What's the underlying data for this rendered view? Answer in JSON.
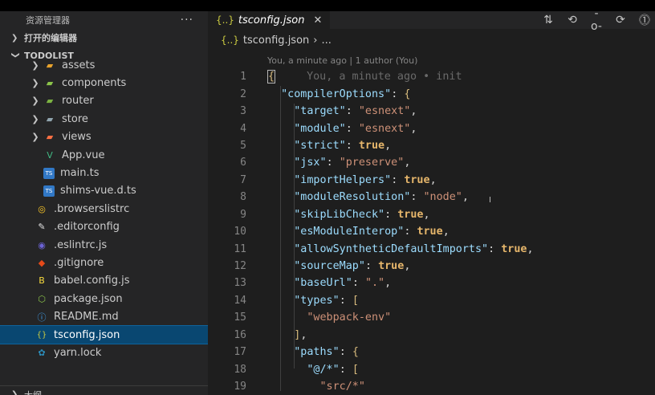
{
  "sidebar": {
    "title": "资源管理器",
    "more": "···",
    "open_editors": "打开的编辑器",
    "project": "TODOLIST",
    "items": [
      {
        "label": "assets",
        "type": "folder",
        "color": "#e8a32d",
        "icon": "folder-icon"
      },
      {
        "label": "components",
        "type": "folder",
        "color": "#8bc34a",
        "icon": "folder-icon"
      },
      {
        "label": "router",
        "type": "folder",
        "color": "#7cb342",
        "icon": "folder-icon"
      },
      {
        "label": "store",
        "type": "folder",
        "color": "#90a4ae",
        "icon": "folder-icon"
      },
      {
        "label": "views",
        "type": "folder",
        "color": "#ff7043",
        "icon": "folder-icon"
      },
      {
        "label": "App.vue",
        "type": "file",
        "color": "#41b883",
        "icon": "vue-icon"
      },
      {
        "label": "main.ts",
        "type": "file",
        "color": "#3178c6",
        "icon": "typescript-icon"
      },
      {
        "label": "shims-vue.d.ts",
        "type": "file",
        "color": "#3178c6",
        "icon": "typescript-icon"
      },
      {
        "label": ".browserslistrc",
        "type": "file",
        "color": "#ffca28",
        "icon": "browserslist-icon"
      },
      {
        "label": ".editorconfig",
        "type": "file",
        "color": "#e0e0e0",
        "icon": "editorconfig-icon"
      },
      {
        "label": ".eslintrc.js",
        "type": "file",
        "color": "#6c63d6",
        "icon": "eslint-icon"
      },
      {
        "label": ".gitignore",
        "type": "file",
        "color": "#e64a19",
        "icon": "git-icon"
      },
      {
        "label": "babel.config.js",
        "type": "file",
        "color": "#f9dc3e",
        "icon": "babel-icon"
      },
      {
        "label": "package.json",
        "type": "file",
        "color": "#8bc34a",
        "icon": "nodejs-icon"
      },
      {
        "label": "README.md",
        "type": "file",
        "color": "#42a5f5",
        "icon": "info-icon"
      },
      {
        "label": "tsconfig.json",
        "type": "file",
        "color": "#cbcb41",
        "icon": "json-icon",
        "selected": true
      },
      {
        "label": "yarn.lock",
        "type": "file",
        "color": "#2c8ebb",
        "icon": "yarn-icon"
      }
    ],
    "bottom_section": "大纲"
  },
  "editor": {
    "tab_label": "tsconfig.json",
    "tab_icon": "{..}",
    "breadcrumb_file": "tsconfig.json",
    "breadcrumb_more": "...",
    "codelens": "You, a minute ago | 1 author (You)",
    "blame": "You, a minute ago • init",
    "lines": [
      {
        "n": "1"
      },
      {
        "n": "2"
      },
      {
        "n": "3"
      },
      {
        "n": "4"
      },
      {
        "n": "5"
      },
      {
        "n": "6"
      },
      {
        "n": "7"
      },
      {
        "n": "8"
      },
      {
        "n": "9"
      },
      {
        "n": "10"
      },
      {
        "n": "11"
      },
      {
        "n": "12"
      },
      {
        "n": "13"
      },
      {
        "n": "14"
      },
      {
        "n": "15"
      },
      {
        "n": "16"
      },
      {
        "n": "17"
      },
      {
        "n": "18"
      },
      {
        "n": "19"
      }
    ],
    "code": {
      "compilerOptions": "\"compilerOptions\"",
      "target_k": "\"target\"",
      "target_v": "\"esnext\"",
      "module_k": "\"module\"",
      "module_v": "\"esnext\"",
      "strict_k": "\"strict\"",
      "true": "true",
      "jsx_k": "\"jsx\"",
      "jsx_v": "\"preserve\"",
      "importHelpers_k": "\"importHelpers\"",
      "moduleResolution_k": "\"moduleResolution\"",
      "moduleResolution_v": "\"node\"",
      "skipLibCheck_k": "\"skipLibCheck\"",
      "esModuleInterop_k": "\"esModuleInterop\"",
      "allowSynthetic_k": "\"allowSyntheticDefaultImports\"",
      "sourceMap_k": "\"sourceMap\"",
      "baseUrl_k": "\"baseUrl\"",
      "baseUrl_v": "\".\"",
      "types_k": "\"types\"",
      "webpack_env": "\"webpack-env\"",
      "paths_k": "\"paths\"",
      "at_k": "\"@/*\"",
      "src_v": "\"src/*\""
    }
  }
}
